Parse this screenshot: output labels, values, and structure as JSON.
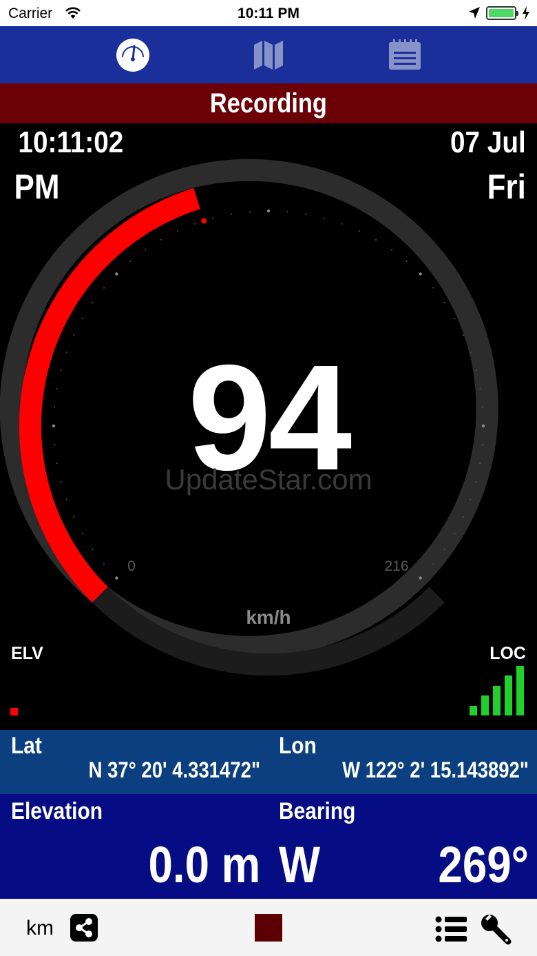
{
  "status_bar": {
    "carrier": "Carrier",
    "time": "10:11 PM"
  },
  "nav": {
    "tabs": [
      {
        "icon": "speedometer-icon",
        "active": true
      },
      {
        "icon": "map-icon",
        "active": false
      },
      {
        "icon": "notepad-icon",
        "active": false
      }
    ]
  },
  "banner": {
    "label": "Recording",
    "color": "#6b0006"
  },
  "clock": {
    "time": "10:11:02",
    "ampm": "PM",
    "date": "07 Jul",
    "weekday": "Fri"
  },
  "speedometer": {
    "speed": "94",
    "min_label": "0",
    "max_label": "216",
    "unit": "km/h",
    "min": 0,
    "max": 216,
    "value": 94,
    "active_color": "#ff0000",
    "track_color": "#2c2c2c"
  },
  "watermark": "UpdateStar.com",
  "indicators": {
    "elevation_label": "ELV",
    "location_label": "LOC",
    "signal_level": 5,
    "signal_max": 5,
    "signal_color": "#1fd12a"
  },
  "coordinates": {
    "lat_label": "Lat",
    "lat_value": "N 37° 20' 4.331472\"",
    "lon_label": "Lon",
    "lon_value": "W 122° 2' 15.143892\""
  },
  "readouts": {
    "elevation_label": "Elevation",
    "elevation_value": "0.0 m",
    "bearing_label": "Bearing",
    "bearing_direction": "W",
    "bearing_degrees": "269°"
  },
  "toolbar": {
    "unit": "km"
  }
}
